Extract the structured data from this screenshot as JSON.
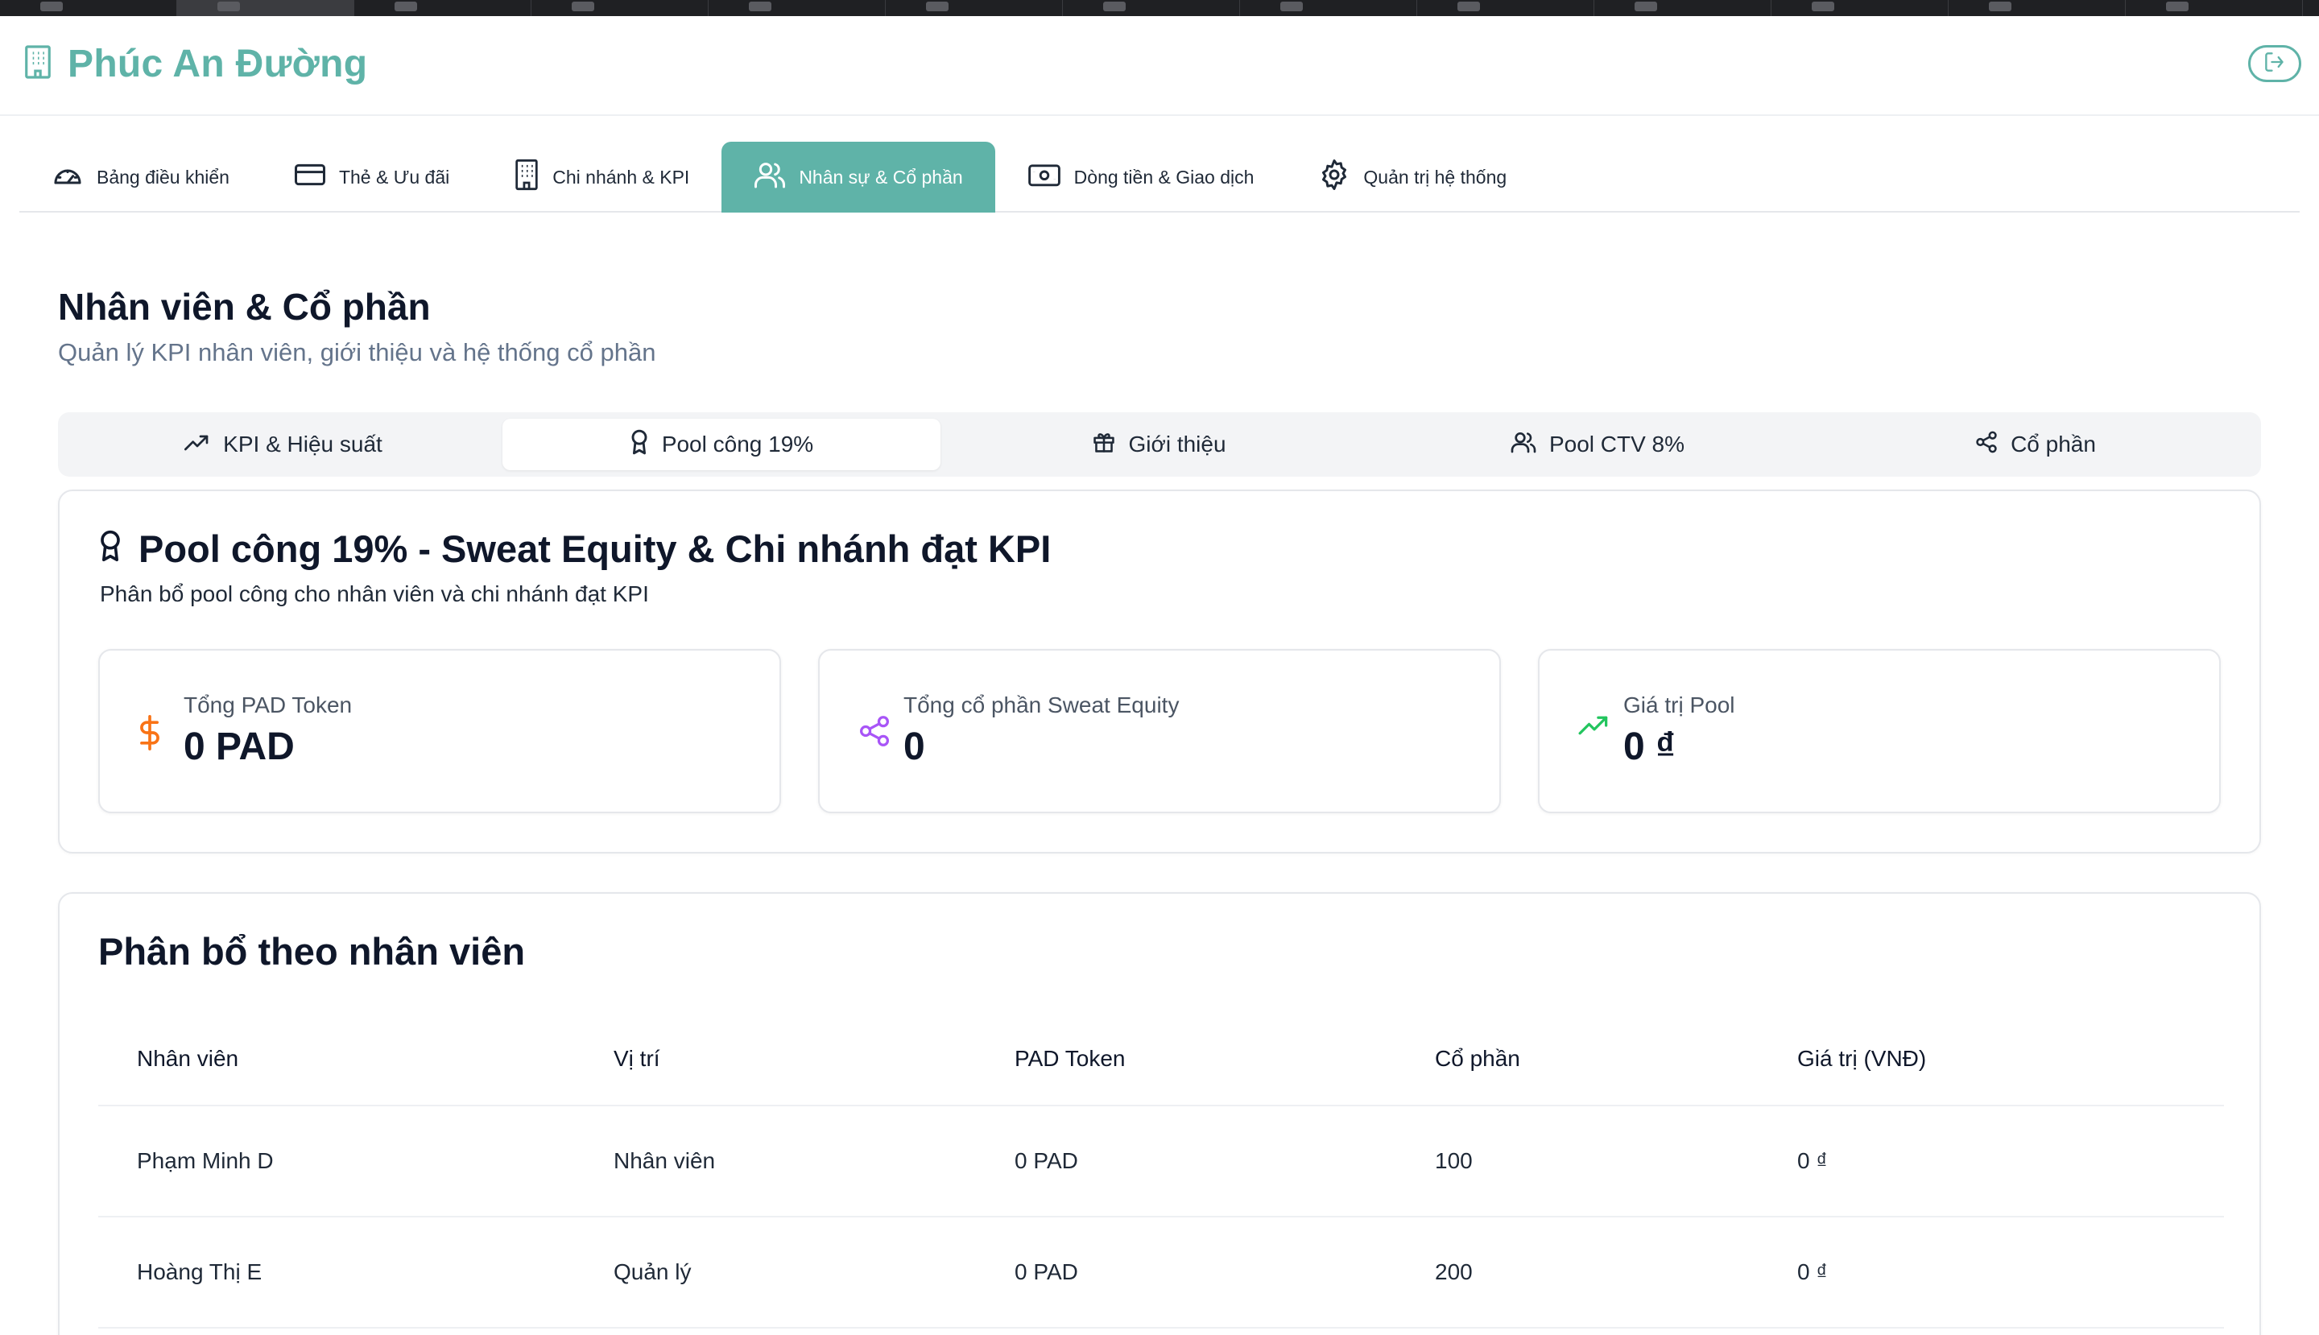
{
  "brand": {
    "name": "Phúc An Đường"
  },
  "main_nav": [
    {
      "label": "Bảng điều khiển",
      "icon": "gauge-icon"
    },
    {
      "label": "Thẻ & Ưu đãi",
      "icon": "credit-card-icon"
    },
    {
      "label": "Chi nhánh & KPI",
      "icon": "building-icon"
    },
    {
      "label": "Nhân sự & Cổ phần",
      "icon": "users-icon",
      "active": true
    },
    {
      "label": "Dòng tiền & Giao dịch",
      "icon": "banknote-icon"
    },
    {
      "label": "Quản trị hệ thống",
      "icon": "gear-icon"
    }
  ],
  "page": {
    "title": "Nhân viên & Cổ phần",
    "subtitle": "Quản lý KPI nhân viên, giới thiệu và hệ thống cổ phần"
  },
  "sub_tabs": [
    {
      "label": "KPI & Hiệu suất",
      "icon": "trending-up-icon"
    },
    {
      "label": "Pool công 19%",
      "icon": "award-icon",
      "active": true
    },
    {
      "label": "Giới thiệu",
      "icon": "gift-icon"
    },
    {
      "label": "Pool CTV 8%",
      "icon": "users-icon"
    },
    {
      "label": "Cổ phần",
      "icon": "share-icon"
    }
  ],
  "pool_card": {
    "title": "Pool công 19% - Sweat Equity & Chi nhánh đạt KPI",
    "description": "Phân bổ pool công cho nhân viên và chi nhánh đạt KPI",
    "stats": [
      {
        "label": "Tổng PAD Token",
        "value": "0 PAD",
        "icon": "dollar-icon",
        "color": "#f97316"
      },
      {
        "label": "Tổng cổ phần Sweat Equity",
        "value": "0",
        "icon": "share-icon",
        "color": "#a855f7"
      },
      {
        "label": "Giá trị Pool",
        "value": "0 ₫",
        "icon": "trending-up-icon",
        "color": "#22c55e"
      }
    ]
  },
  "allocation": {
    "title": "Phân bổ theo nhân viên",
    "columns": [
      "Nhân viên",
      "Vị trí",
      "PAD Token",
      "Cổ phần",
      "Giá trị (VNĐ)"
    ],
    "rows": [
      [
        "Phạm Minh D",
        "Nhân viên",
        "0 PAD",
        "100",
        "0 ₫"
      ],
      [
        "Hoàng Thị E",
        "Quản lý",
        "0 PAD",
        "200",
        "0 ₫"
      ]
    ]
  },
  "colors": {
    "accent": "#5fb3a8"
  }
}
